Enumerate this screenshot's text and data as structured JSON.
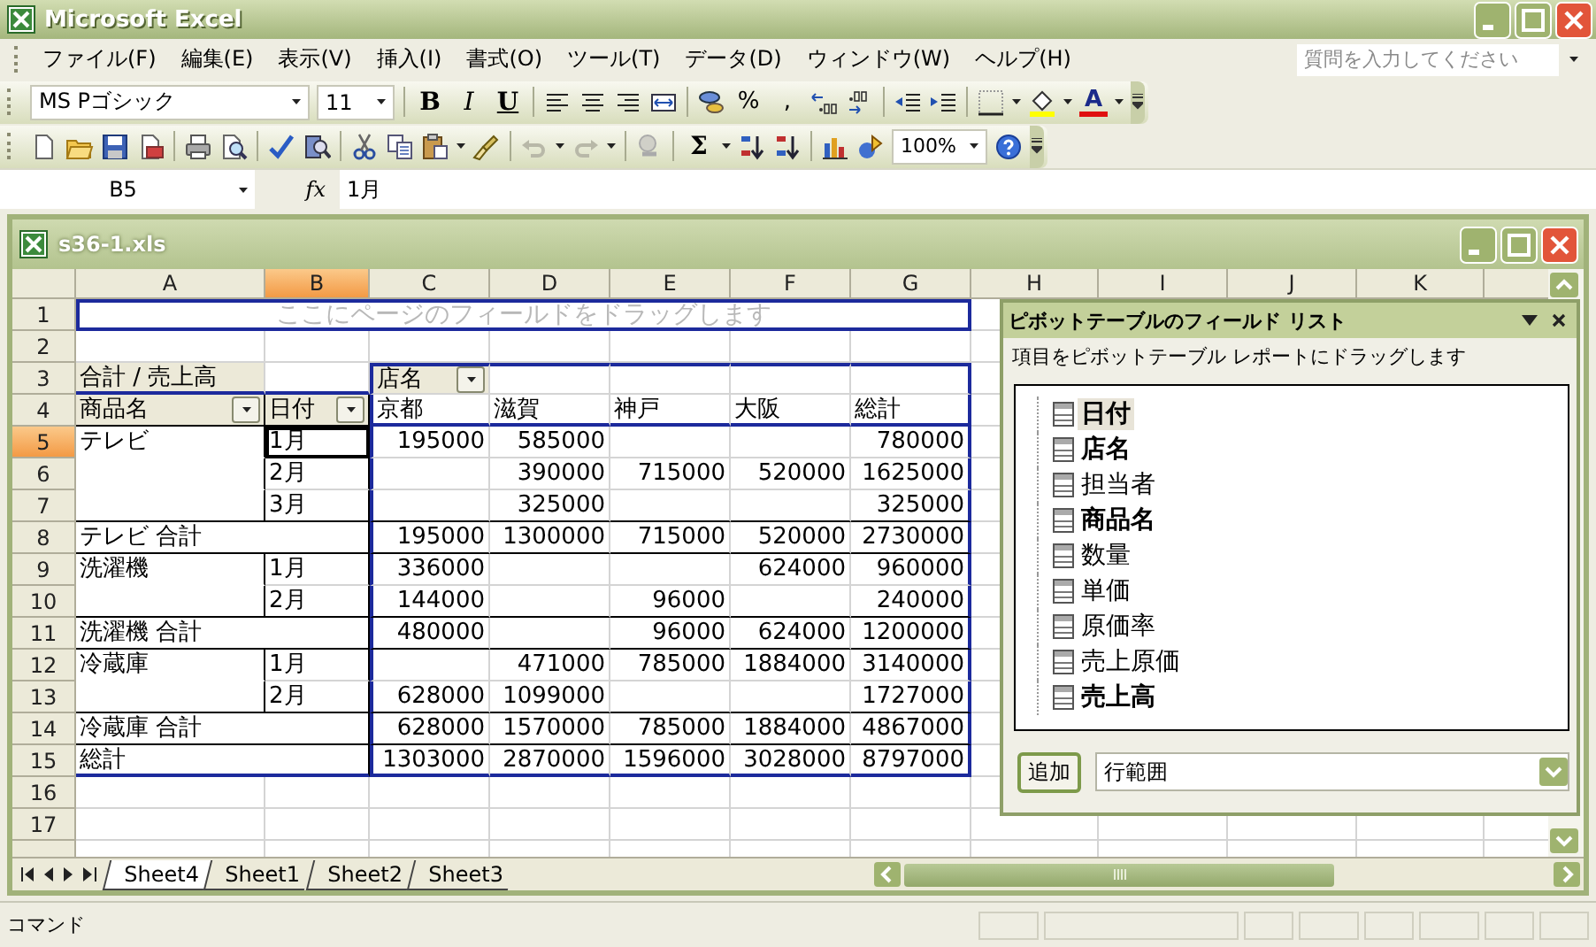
{
  "app": {
    "title": "Microsoft Excel"
  },
  "menu": [
    {
      "label": "ファイル(F)"
    },
    {
      "label": "編集(E)"
    },
    {
      "label": "表示(V)"
    },
    {
      "label": "挿入(I)"
    },
    {
      "label": "書式(O)"
    },
    {
      "label": "ツール(T)"
    },
    {
      "label": "データ(D)"
    },
    {
      "label": "ウィンドウ(W)"
    },
    {
      "label": "ヘルプ(H)"
    }
  ],
  "help_box": {
    "placeholder": "質問を入力してください"
  },
  "formatting_toolbar": {
    "font": "MS Pゴシック",
    "size": "11",
    "bold": "B",
    "italic": "I",
    "underline": "U",
    "percent": "%",
    "comma": ",",
    "font_color": "A"
  },
  "standard_toolbar": {
    "sum": "Σ",
    "zoom": "100%"
  },
  "formula_bar": {
    "name_box": "B5",
    "fx": "fx",
    "value": "1月"
  },
  "workbook": {
    "title": "s36-1.xls",
    "columns": [
      {
        "label": "A",
        "selected": false
      },
      {
        "label": "B",
        "selected": true
      },
      {
        "label": "C",
        "selected": false
      },
      {
        "label": "D",
        "selected": false
      },
      {
        "label": "E",
        "selected": false
      },
      {
        "label": "F",
        "selected": false
      },
      {
        "label": "G",
        "selected": false
      },
      {
        "label": "H",
        "selected": false
      },
      {
        "label": "I",
        "selected": false
      },
      {
        "label": "J",
        "selected": false
      },
      {
        "label": "K",
        "selected": false
      }
    ],
    "rows": [
      {
        "header": "1",
        "selected": false,
        "kind": "page",
        "text": "ここにページのフィールドをドラッグします"
      },
      {
        "header": "2",
        "selected": false,
        "kind": "empty"
      },
      {
        "header": "3",
        "selected": false,
        "kind": "fields",
        "cells": {
          "a": {
            "text": "合計 / 売上高",
            "kind": "data-field"
          },
          "c": {
            "text": "店名",
            "kind": "field"
          }
        }
      },
      {
        "header": "4",
        "selected": false,
        "kind": "labels",
        "cells": {
          "a": {
            "text": "商品名",
            "kind": "field"
          },
          "b": {
            "text": "日付",
            "kind": "field"
          },
          "c": "京都",
          "d": "滋賀",
          "e": "神戸",
          "f": "大阪",
          "g": "総計"
        }
      },
      {
        "header": "5",
        "selected": true,
        "kind": "item",
        "cells": {
          "a": "テレビ",
          "b": "1月",
          "c": "195000",
          "d": "585000",
          "g": "780000"
        }
      },
      {
        "header": "6",
        "selected": false,
        "kind": "item",
        "cells": {
          "b": "2月",
          "d": "390000",
          "e": "715000",
          "f": "520000",
          "g": "1625000"
        }
      },
      {
        "header": "7",
        "selected": false,
        "kind": "item",
        "cells": {
          "b": "3月",
          "d": "325000",
          "g": "325000"
        }
      },
      {
        "header": "8",
        "selected": false,
        "kind": "subtotal",
        "label": "テレビ 合計",
        "cells": {
          "c": "195000",
          "d": "1300000",
          "e": "715000",
          "f": "520000",
          "g": "2730000"
        }
      },
      {
        "header": "9",
        "selected": false,
        "kind": "item",
        "cells": {
          "a": "洗濯機",
          "b": "1月",
          "c": "336000",
          "f": "624000",
          "g": "960000"
        }
      },
      {
        "header": "10",
        "selected": false,
        "kind": "item",
        "cells": {
          "b": "2月",
          "c": "144000",
          "e": "96000",
          "g": "240000"
        }
      },
      {
        "header": "11",
        "selected": false,
        "kind": "subtotal",
        "label": "洗濯機 合計",
        "cells": {
          "c": "480000",
          "e": "96000",
          "f": "624000",
          "g": "1200000"
        }
      },
      {
        "header": "12",
        "selected": false,
        "kind": "item",
        "cells": {
          "a": "冷蔵庫",
          "b": "1月",
          "d": "471000",
          "e": "785000",
          "f": "1884000",
          "g": "3140000"
        }
      },
      {
        "header": "13",
        "selected": false,
        "kind": "item",
        "cells": {
          "b": "2月",
          "c": "628000",
          "d": "1099000",
          "g": "1727000"
        }
      },
      {
        "header": "14",
        "selected": false,
        "kind": "subtotal",
        "label": "冷蔵庫 合計",
        "cells": {
          "c": "628000",
          "d": "1570000",
          "e": "785000",
          "f": "1884000",
          "g": "4867000"
        }
      },
      {
        "header": "15",
        "selected": false,
        "kind": "total",
        "label": "総計",
        "cells": {
          "c": "1303000",
          "d": "2870000",
          "e": "1596000",
          "f": "3028000",
          "g": "8797000"
        }
      },
      {
        "header": "16",
        "selected": false,
        "kind": "empty"
      },
      {
        "header": "17",
        "selected": false,
        "kind": "empty"
      }
    ],
    "sheet_tabs": [
      {
        "label": "Sheet4",
        "selected": true
      },
      {
        "label": "Sheet1",
        "selected": false
      },
      {
        "label": "Sheet2",
        "selected": false
      },
      {
        "label": "Sheet3",
        "selected": false
      }
    ]
  },
  "pivot_field_list": {
    "title": "ピボットテーブルのフィールド リスト",
    "hint": "項目をピボットテーブル レポートにドラッグします",
    "fields": [
      {
        "label": "日付",
        "used": true,
        "selected": true
      },
      {
        "label": "店名",
        "used": true,
        "selected": false
      },
      {
        "label": "担当者",
        "used": false,
        "selected": false
      },
      {
        "label": "商品名",
        "used": true,
        "selected": false
      },
      {
        "label": "数量",
        "used": false,
        "selected": false
      },
      {
        "label": "単価",
        "used": false,
        "selected": false
      },
      {
        "label": "原価率",
        "used": false,
        "selected": false
      },
      {
        "label": "売上原価",
        "used": false,
        "selected": false
      },
      {
        "label": "売上高",
        "used": true,
        "selected": false
      }
    ],
    "add_button": "追加",
    "area": "行範囲"
  },
  "status_bar": {
    "text": "コマンド"
  }
}
